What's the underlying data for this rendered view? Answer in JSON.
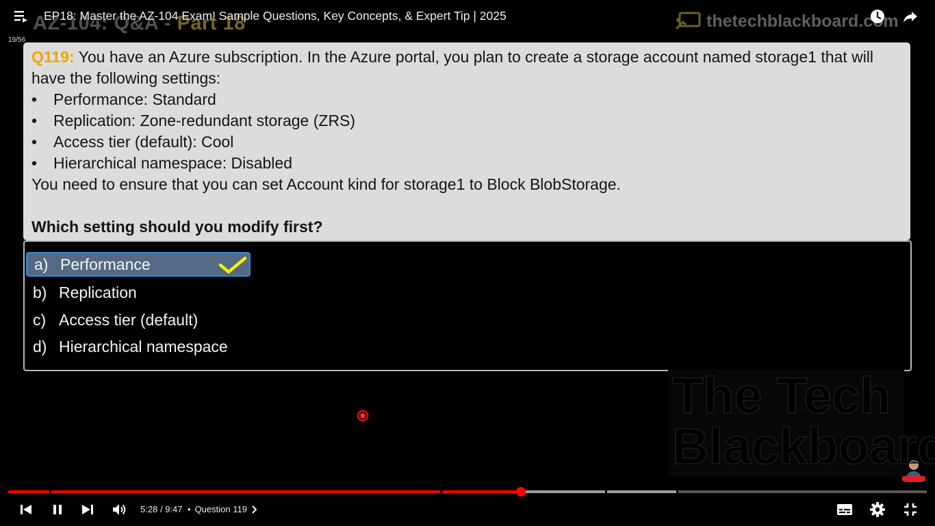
{
  "player": {
    "title": "EP18: Master the AZ-104 Exam! Sample Questions, Key Concepts, & Expert Tip | 2025",
    "playlist_position": "19/56",
    "current_time": "5:28",
    "separator": "/",
    "duration": "9:47",
    "chapter_bullet": "•",
    "chapter_title": "Question 119",
    "progress_fraction": 0.558,
    "buffered_fraction": 0.727,
    "accent_color": "#ff0000"
  },
  "slide": {
    "heading_main": "AZ-104: Q&A -",
    "heading_part": "Part 18",
    "brand_text": "thetechblackboard.com",
    "watermark_line1": "The Tech",
    "watermark_line2": "Blackboard"
  },
  "question": {
    "number": "Q119:",
    "intro_line1": "You have an Azure subscription. In the Azure portal, you plan to create a storage account named storage1 that will",
    "intro_line2": "have the following settings:",
    "settings": [
      "Performance: Standard",
      "Replication: Zone-redundant storage (ZRS)",
      "Access tier (default): Cool",
      "Hierarchical namespace: Disabled"
    ],
    "requirement": "You need to ensure that you can set Account kind for storage1 to Block BlobStorage.",
    "prompt": "Which setting should you modify first?"
  },
  "answers": [
    {
      "letter": "a)",
      "text": "Performance",
      "selected": true
    },
    {
      "letter": "b)",
      "text": "Replication",
      "selected": false
    },
    {
      "letter": "c)",
      "text": "Access tier (default)",
      "selected": false
    },
    {
      "letter": "d)",
      "text": "Hierarchical namespace",
      "selected": false
    }
  ],
  "icons": {
    "playlist": "playlist-icon",
    "watch_later": "clock-icon",
    "share": "share-arrow-icon",
    "previous": "skip-previous-icon",
    "pause": "pause-icon",
    "next": "skip-next-icon",
    "volume": "volume-icon",
    "subtitles": "subtitles-icon",
    "settings": "gear-icon",
    "exit_fullscreen": "exit-fullscreen-icon",
    "answer_check": "checkmark-icon"
  }
}
